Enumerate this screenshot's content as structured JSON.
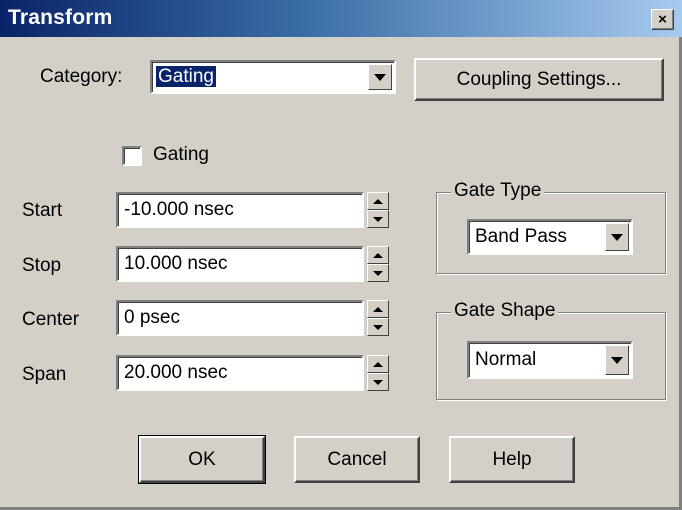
{
  "window": {
    "title": "Transform",
    "close_glyph": "×"
  },
  "category": {
    "label": "Category:",
    "value": "Gating"
  },
  "coupling_button": {
    "label": "Coupling Settings..."
  },
  "gating_checkbox": {
    "label": "Gating",
    "checked": false
  },
  "fields": [
    {
      "label": "Start",
      "value": "-10.000 nsec"
    },
    {
      "label": "Stop",
      "value": "10.000 nsec"
    },
    {
      "label": "Center",
      "value": "0 psec"
    },
    {
      "label": "Span",
      "value": "20.000 nsec"
    }
  ],
  "gate_type": {
    "legend": "Gate Type",
    "value": "Band Pass"
  },
  "gate_shape": {
    "legend": "Gate Shape",
    "value": "Normal"
  },
  "buttons": {
    "ok": "OK",
    "cancel": "Cancel",
    "help": "Help"
  },
  "colors": {
    "titlebar_start": "#0a246a",
    "face": "#d4d0c8",
    "selection": "#0a246a"
  }
}
